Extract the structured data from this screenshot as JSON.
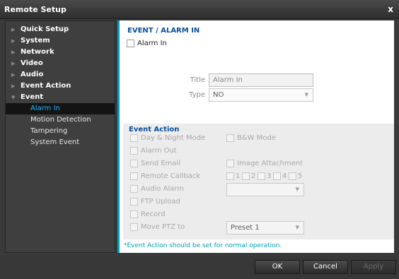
{
  "window": {
    "title": "Remote Setup",
    "close_glyph": "x"
  },
  "sidebar": {
    "items": [
      {
        "label": "Quick Setup",
        "arrow": "▶"
      },
      {
        "label": "System",
        "arrow": "▶"
      },
      {
        "label": "Network",
        "arrow": "▶"
      },
      {
        "label": "Video",
        "arrow": "▶"
      },
      {
        "label": "Audio",
        "arrow": "▶"
      },
      {
        "label": "Event Action",
        "arrow": "▶"
      },
      {
        "label": "Event",
        "arrow": "▼"
      }
    ],
    "subitems": [
      {
        "label": "Alarm In",
        "active": true
      },
      {
        "label": "Motion Detection"
      },
      {
        "label": "Tampering"
      },
      {
        "label": "System Event"
      }
    ]
  },
  "main": {
    "heading": "EVENT / ALARM IN",
    "alarm_in_label": "Alarm In",
    "title_label": "Title",
    "title_value": "Alarm In",
    "type_label": "Type",
    "type_value": "NO"
  },
  "event_action": {
    "heading": "Event Action",
    "day_night": "Day & Night Mode",
    "bw_mode": "B&W Mode",
    "alarm_out": "Alarm Out",
    "send_email": "Send Email",
    "image_attachment": "Image Attachment",
    "remote_callback": "Remote Callback",
    "callback_numbers": [
      "1",
      "2",
      "3",
      "4",
      "5"
    ],
    "audio_alarm": "Audio Alarm",
    "audio_select": "",
    "ftp_upload": "FTP Upload",
    "record": "Record",
    "move_ptz": "Move PTZ to",
    "ptz_select": "Preset  1"
  },
  "note": "*Event Action should be set for normal operation.",
  "footer": {
    "ok": "OK",
    "cancel": "Cancel",
    "apply": "Apply"
  },
  "colors": {
    "accent": "#00a0b8",
    "heading_blue": "#0a4fa0",
    "active_sub": "#19b8ff"
  }
}
